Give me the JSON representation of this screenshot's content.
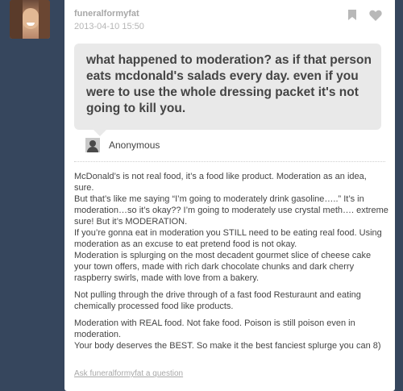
{
  "post": {
    "username": "funeralformyfat",
    "timestamp": "2013-04-10 15:50",
    "question": "what happened to moderation? as if that person eats mcdonald's salads every day. even if you were to use the whole dressing packet it's not going to kill you.",
    "asker": "Anonymous",
    "answer": {
      "p1_lines": [
        "McDonald’s is not real food, it’s a food like product. Moderation as an idea, sure.",
        "But that’s like me saying “I’m going to moderately drink gasoline…..” It’s in moderation…so it’s okay?? I’m going to moderately use crystal meth…. extreme sure! But it’s MODERATION.",
        "If you’re gonna eat in moderation you STILL need to be eating real food. Using moderation as an excuse to eat pretend food is not okay.",
        "Moderation is splurging on the most decadent gourmet slice of cheese cake your town offers, made with rich dark chocolate chunks and dark cherry raspberry swirls, made with love from a bakery."
      ],
      "p2": "Not pulling through the drive through of a fast food Resturaunt and eating chemically processed food like products.",
      "p3_lines": [
        "Moderation with REAL food. Not fake food. Poison is still poison even in moderation.",
        "Your body deserves the BEST. So make it the best fanciest splurge you can 8)"
      ]
    },
    "ask_link": "Ask funeralformyfat a question"
  },
  "icons": {
    "bookmark": "bookmark-icon",
    "like": "heart-icon",
    "asker_avatar": "anonymous-avatar-icon"
  },
  "colors": {
    "background": "#36465d",
    "card": "#ffffff",
    "question_bg": "#e9e9e9",
    "muted_text": "#a8a8a8"
  }
}
